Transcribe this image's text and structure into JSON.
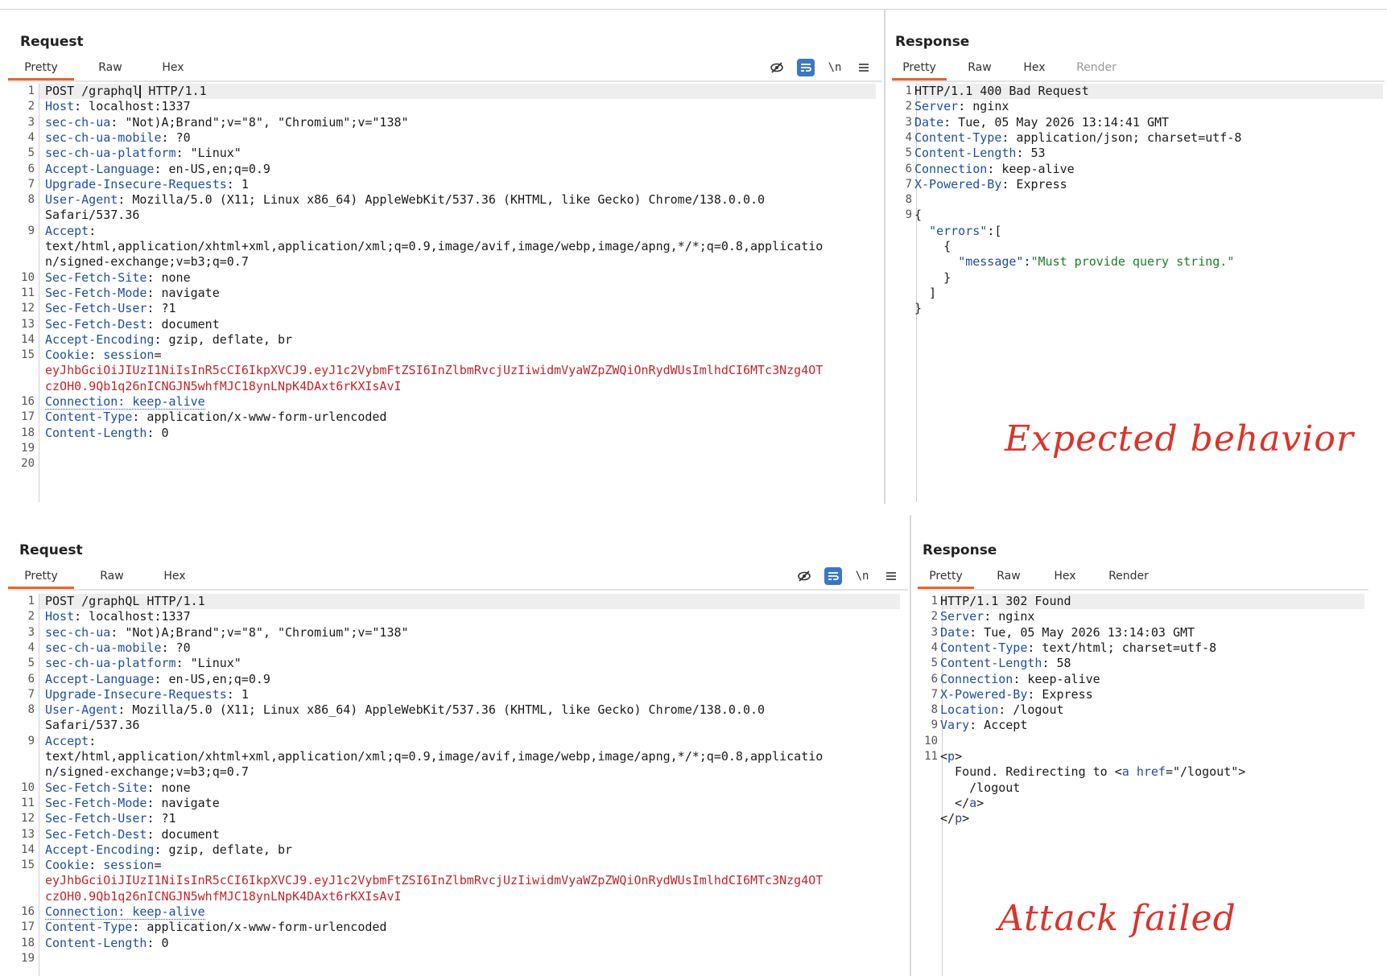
{
  "top": {
    "request": {
      "title": "Request",
      "tabs": [
        "Pretty",
        "Raw",
        "Hex"
      ],
      "lines": [
        {
          "n": "1",
          "parts": [
            {
              "t": "POST /graphql",
              "c": ""
            },
            {
              "caret": true
            },
            {
              "t": " HTTP/1.1",
              "c": ""
            }
          ]
        },
        {
          "n": "2",
          "parts": [
            {
              "t": "Host",
              "c": "hdr"
            },
            {
              "t": ": localhost:1337",
              "c": ""
            }
          ]
        },
        {
          "n": "3",
          "parts": [
            {
              "t": "sec-ch-ua",
              "c": "hdr"
            },
            {
              "t": ": \"Not)A;Brand\";v=\"8\", \"Chromium\";v=\"138\"",
              "c": ""
            }
          ]
        },
        {
          "n": "4",
          "parts": [
            {
              "t": "sec-ch-ua-mobile",
              "c": "hdr"
            },
            {
              "t": ": ?0",
              "c": ""
            }
          ]
        },
        {
          "n": "5",
          "parts": [
            {
              "t": "sec-ch-ua-platform",
              "c": "hdr"
            },
            {
              "t": ": \"Linux\"",
              "c": ""
            }
          ]
        },
        {
          "n": "6",
          "parts": [
            {
              "t": "Accept-Language",
              "c": "hdr"
            },
            {
              "t": ": en-US,en;q=0.9",
              "c": ""
            }
          ]
        },
        {
          "n": "7",
          "parts": [
            {
              "t": "Upgrade-Insecure-Requests",
              "c": "hdr"
            },
            {
              "t": ": 1",
              "c": ""
            }
          ]
        },
        {
          "n": "8",
          "parts": [
            {
              "t": "User-Agent",
              "c": "hdr"
            },
            {
              "t": ": Mozilla/5.0 (X11; Linux x86_64) AppleWebKit/537.36 (KHTML, like Gecko) Chrome/138.0.0.0",
              "c": ""
            }
          ]
        },
        {
          "n": "",
          "parts": [
            {
              "t": "Safari/537.36",
              "c": ""
            }
          ]
        },
        {
          "n": "9",
          "parts": [
            {
              "t": "Accept",
              "c": "hdr"
            },
            {
              "t": ":",
              "c": ""
            }
          ]
        },
        {
          "n": "",
          "parts": [
            {
              "t": "text/html,application/xhtml+xml,application/xml;q=0.9,image/avif,image/webp,image/apng,*/*;q=0.8,applicatio",
              "c": ""
            }
          ]
        },
        {
          "n": "",
          "parts": [
            {
              "t": "n/signed-exchange;v=b3;q=0.7",
              "c": ""
            }
          ]
        },
        {
          "n": "10",
          "parts": [
            {
              "t": "Sec-Fetch-Site",
              "c": "hdr"
            },
            {
              "t": ": none",
              "c": ""
            }
          ]
        },
        {
          "n": "11",
          "parts": [
            {
              "t": "Sec-Fetch-Mode",
              "c": "hdr"
            },
            {
              "t": ": navigate",
              "c": ""
            }
          ]
        },
        {
          "n": "12",
          "parts": [
            {
              "t": "Sec-Fetch-User",
              "c": "hdr"
            },
            {
              "t": ": ?1",
              "c": ""
            }
          ]
        },
        {
          "n": "13",
          "parts": [
            {
              "t": "Sec-Fetch-Dest",
              "c": "hdr"
            },
            {
              "t": ": document",
              "c": ""
            }
          ]
        },
        {
          "n": "14",
          "parts": [
            {
              "t": "Accept-Encoding",
              "c": "hdr"
            },
            {
              "t": ": gzip, deflate, br",
              "c": ""
            }
          ]
        },
        {
          "n": "15",
          "parts": [
            {
              "t": "Cookie",
              "c": "hdr"
            },
            {
              "t": ": ",
              "c": ""
            },
            {
              "t": "session",
              "c": "hdr"
            },
            {
              "t": "=",
              "c": ""
            }
          ]
        },
        {
          "n": "",
          "parts": [
            {
              "t": "eyJhbGciOiJIUzI1NiIsInR5cCI6IkpXVCJ9.eyJ1c2VybmFtZSI6InZlbmRvcjUzIiwidmVyaWZpZWQiOnRydWUsImlhdCI6MTc3Nzg4OT",
              "c": "red"
            }
          ]
        },
        {
          "n": "",
          "parts": [
            {
              "t": "czOH0.9Qb1q26nICNGJN5whfMJC18ynLNpK4DAxt6rKXIsAvI",
              "c": "red"
            }
          ]
        },
        {
          "n": "16",
          "parts": [
            {
              "t": "Connection: keep-alive",
              "c": "hdr dotted"
            }
          ]
        },
        {
          "n": "17",
          "parts": [
            {
              "t": "Content-Type",
              "c": "hdr"
            },
            {
              "t": ": application/x-www-form-urlencoded",
              "c": ""
            }
          ]
        },
        {
          "n": "18",
          "parts": [
            {
              "t": "Content-Length",
              "c": "hdr"
            },
            {
              "t": ": 0",
              "c": ""
            }
          ]
        },
        {
          "n": "19",
          "parts": []
        },
        {
          "n": "20",
          "parts": []
        }
      ]
    },
    "response": {
      "title": "Response",
      "tabs": [
        "Pretty",
        "Raw",
        "Hex",
        "Render"
      ],
      "lines": [
        {
          "n": "1",
          "parts": [
            {
              "t": "HTTP/1.1 400 Bad Request",
              "c": ""
            }
          ]
        },
        {
          "n": "2",
          "parts": [
            {
              "t": "Server",
              "c": "hdr"
            },
            {
              "t": ": nginx",
              "c": ""
            }
          ]
        },
        {
          "n": "3",
          "parts": [
            {
              "t": "Date",
              "c": "hdr"
            },
            {
              "t": ": Tue, 05 May 2026 13:14:41 GMT",
              "c": ""
            }
          ]
        },
        {
          "n": "4",
          "parts": [
            {
              "t": "Content-Type",
              "c": "hdr"
            },
            {
              "t": ": application/json; charset=utf-8",
              "c": ""
            }
          ]
        },
        {
          "n": "5",
          "parts": [
            {
              "t": "Content-Length",
              "c": "hdr"
            },
            {
              "t": ": 53",
              "c": ""
            }
          ]
        },
        {
          "n": "6",
          "parts": [
            {
              "t": "Connection",
              "c": "hdr"
            },
            {
              "t": ": keep-alive",
              "c": ""
            }
          ]
        },
        {
          "n": "7",
          "parts": [
            {
              "t": "X-Powered-By",
              "c": "hdr"
            },
            {
              "t": ": Express",
              "c": ""
            }
          ]
        },
        {
          "n": "8",
          "parts": []
        },
        {
          "n": "9",
          "parts": [
            {
              "t": "{",
              "c": ""
            }
          ]
        },
        {
          "n": "",
          "parts": [
            {
              "t": "  ",
              "c": ""
            },
            {
              "t": "\"errors\"",
              "c": "hdr"
            },
            {
              "t": ":[",
              "c": ""
            }
          ]
        },
        {
          "n": "",
          "parts": [
            {
              "t": "    {",
              "c": ""
            }
          ]
        },
        {
          "n": "",
          "parts": [
            {
              "t": "      ",
              "c": ""
            },
            {
              "t": "\"message\"",
              "c": "hdr"
            },
            {
              "t": ":",
              "c": ""
            },
            {
              "t": "\"Must provide query string.\"",
              "c": "grn"
            }
          ]
        },
        {
          "n": "",
          "parts": [
            {
              "t": "    }",
              "c": ""
            }
          ]
        },
        {
          "n": "",
          "parts": [
            {
              "t": "  ]",
              "c": ""
            }
          ]
        },
        {
          "n": "",
          "parts": [
            {
              "t": "}",
              "c": ""
            }
          ]
        }
      ]
    },
    "note": "Expected behavior"
  },
  "bottom": {
    "request": {
      "title": "Request",
      "tabs": [
        "Pretty",
        "Raw",
        "Hex"
      ],
      "lines": [
        {
          "n": "1",
          "parts": [
            {
              "t": "POST /graphQL HTTP/1.1",
              "c": ""
            }
          ]
        },
        {
          "n": "2",
          "parts": [
            {
              "t": "Host",
              "c": "hdr"
            },
            {
              "t": ": localhost:1337",
              "c": ""
            }
          ]
        },
        {
          "n": "3",
          "parts": [
            {
              "t": "sec-ch-ua",
              "c": "hdr"
            },
            {
              "t": ": \"Not)A;Brand\";v=\"8\", \"Chromium\";v=\"138\"",
              "c": ""
            }
          ]
        },
        {
          "n": "4",
          "parts": [
            {
              "t": "sec-ch-ua-mobile",
              "c": "hdr"
            },
            {
              "t": ": ?0",
              "c": ""
            }
          ]
        },
        {
          "n": "5",
          "parts": [
            {
              "t": "sec-ch-ua-platform",
              "c": "hdr"
            },
            {
              "t": ": \"Linux\"",
              "c": ""
            }
          ]
        },
        {
          "n": "6",
          "parts": [
            {
              "t": "Accept-Language",
              "c": "hdr"
            },
            {
              "t": ": en-US,en;q=0.9",
              "c": ""
            }
          ]
        },
        {
          "n": "7",
          "parts": [
            {
              "t": "Upgrade-Insecure-Requests",
              "c": "hdr"
            },
            {
              "t": ": 1",
              "c": ""
            }
          ]
        },
        {
          "n": "8",
          "parts": [
            {
              "t": "User-Agent",
              "c": "hdr"
            },
            {
              "t": ": Mozilla/5.0 (X11; Linux x86_64) AppleWebKit/537.36 (KHTML, like Gecko) Chrome/138.0.0.0",
              "c": ""
            }
          ]
        },
        {
          "n": "",
          "parts": [
            {
              "t": "Safari/537.36",
              "c": ""
            }
          ]
        },
        {
          "n": "9",
          "parts": [
            {
              "t": "Accept",
              "c": "hdr"
            },
            {
              "t": ":",
              "c": ""
            }
          ]
        },
        {
          "n": "",
          "parts": [
            {
              "t": "text/html,application/xhtml+xml,application/xml;q=0.9,image/avif,image/webp,image/apng,*/*;q=0.8,applicatio",
              "c": ""
            }
          ]
        },
        {
          "n": "",
          "parts": [
            {
              "t": "n/signed-exchange;v=b3;q=0.7",
              "c": ""
            }
          ]
        },
        {
          "n": "10",
          "parts": [
            {
              "t": "Sec-Fetch-Site",
              "c": "hdr"
            },
            {
              "t": ": none",
              "c": ""
            }
          ]
        },
        {
          "n": "11",
          "parts": [
            {
              "t": "Sec-Fetch-Mode",
              "c": "hdr"
            },
            {
              "t": ": navigate",
              "c": ""
            }
          ]
        },
        {
          "n": "12",
          "parts": [
            {
              "t": "Sec-Fetch-User",
              "c": "hdr"
            },
            {
              "t": ": ?1",
              "c": ""
            }
          ]
        },
        {
          "n": "13",
          "parts": [
            {
              "t": "Sec-Fetch-Dest",
              "c": "hdr"
            },
            {
              "t": ": document",
              "c": ""
            }
          ]
        },
        {
          "n": "14",
          "parts": [
            {
              "t": "Accept-Encoding",
              "c": "hdr"
            },
            {
              "t": ": gzip, deflate, br",
              "c": ""
            }
          ]
        },
        {
          "n": "15",
          "parts": [
            {
              "t": "Cookie",
              "c": "hdr"
            },
            {
              "t": ": ",
              "c": ""
            },
            {
              "t": "session",
              "c": "hdr"
            },
            {
              "t": "=",
              "c": ""
            }
          ]
        },
        {
          "n": "",
          "parts": [
            {
              "t": "eyJhbGciOiJIUzI1NiIsInR5cCI6IkpXVCJ9.eyJ1c2VybmFtZSI6InZlbmRvcjUzIiwidmVyaWZpZWQiOnRydWUsImlhdCI6MTc3Nzg4OT",
              "c": "red"
            }
          ]
        },
        {
          "n": "",
          "parts": [
            {
              "t": "czOH0.9Qb1q26nICNGJN5whfMJC18ynLNpK4DAxt6rKXIsAvI",
              "c": "red"
            }
          ]
        },
        {
          "n": "16",
          "parts": [
            {
              "t": "Connection: keep-alive",
              "c": "hdr dotted"
            }
          ]
        },
        {
          "n": "17",
          "parts": [
            {
              "t": "Content-Type",
              "c": "hdr"
            },
            {
              "t": ": application/x-www-form-urlencoded",
              "c": ""
            }
          ]
        },
        {
          "n": "18",
          "parts": [
            {
              "t": "Content-Length",
              "c": "hdr"
            },
            {
              "t": ": 0",
              "c": ""
            }
          ]
        },
        {
          "n": "19",
          "parts": []
        }
      ]
    },
    "response": {
      "title": "Response",
      "tabs": [
        "Pretty",
        "Raw",
        "Hex",
        "Render"
      ],
      "lines": [
        {
          "n": "1",
          "parts": [
            {
              "t": "HTTP/1.1 302 Found",
              "c": ""
            }
          ]
        },
        {
          "n": "2",
          "parts": [
            {
              "t": "Server",
              "c": "hdr"
            },
            {
              "t": ": nginx",
              "c": ""
            }
          ]
        },
        {
          "n": "3",
          "parts": [
            {
              "t": "Date",
              "c": "hdr"
            },
            {
              "t": ": Tue, 05 May 2026 13:14:03 GMT",
              "c": ""
            }
          ]
        },
        {
          "n": "4",
          "parts": [
            {
              "t": "Content-Type",
              "c": "hdr"
            },
            {
              "t": ": text/html; charset=utf-8",
              "c": ""
            }
          ]
        },
        {
          "n": "5",
          "parts": [
            {
              "t": "Content-Length",
              "c": "hdr"
            },
            {
              "t": ": 58",
              "c": ""
            }
          ]
        },
        {
          "n": "6",
          "parts": [
            {
              "t": "Connection",
              "c": "hdr"
            },
            {
              "t": ": keep-alive",
              "c": ""
            }
          ]
        },
        {
          "n": "7",
          "parts": [
            {
              "t": "X-Powered-By",
              "c": "hdr"
            },
            {
              "t": ": Express",
              "c": ""
            }
          ]
        },
        {
          "n": "8",
          "parts": [
            {
              "t": "Location",
              "c": "hdr"
            },
            {
              "t": ": /logout",
              "c": ""
            }
          ]
        },
        {
          "n": "9",
          "parts": [
            {
              "t": "Vary",
              "c": "hdr"
            },
            {
              "t": ": Accept",
              "c": ""
            }
          ]
        },
        {
          "n": "10",
          "parts": []
        },
        {
          "n": "11",
          "parts": [
            {
              "t": "<",
              "c": ""
            },
            {
              "t": "p",
              "c": "tag"
            },
            {
              "t": ">",
              "c": ""
            }
          ]
        },
        {
          "n": "",
          "parts": [
            {
              "t": "  Found. Redirecting to <",
              "c": ""
            },
            {
              "t": "a",
              "c": "tag"
            },
            {
              "t": " ",
              "c": ""
            },
            {
              "t": "href",
              "c": "attr"
            },
            {
              "t": "=\"/logout\">",
              "c": ""
            }
          ]
        },
        {
          "n": "",
          "parts": [
            {
              "t": "    /logout",
              "c": ""
            }
          ]
        },
        {
          "n": "",
          "parts": [
            {
              "t": "  </",
              "c": ""
            },
            {
              "t": "a",
              "c": "tag"
            },
            {
              "t": ">",
              "c": ""
            }
          ]
        },
        {
          "n": "",
          "parts": [
            {
              "t": "</",
              "c": ""
            },
            {
              "t": "p",
              "c": "tag"
            },
            {
              "t": ">",
              "c": ""
            }
          ]
        }
      ]
    },
    "note": "Attack failed"
  },
  "icons": [
    "eye-slash-icon",
    "wrap-icon",
    "newline-icon",
    "menu-icon"
  ],
  "colors": {
    "accent": "#e8652b",
    "header_key": "#1f4e9f",
    "cookie_value": "#c0262b",
    "json_string": "#1b7d2a",
    "annotation": "#d9342b"
  }
}
